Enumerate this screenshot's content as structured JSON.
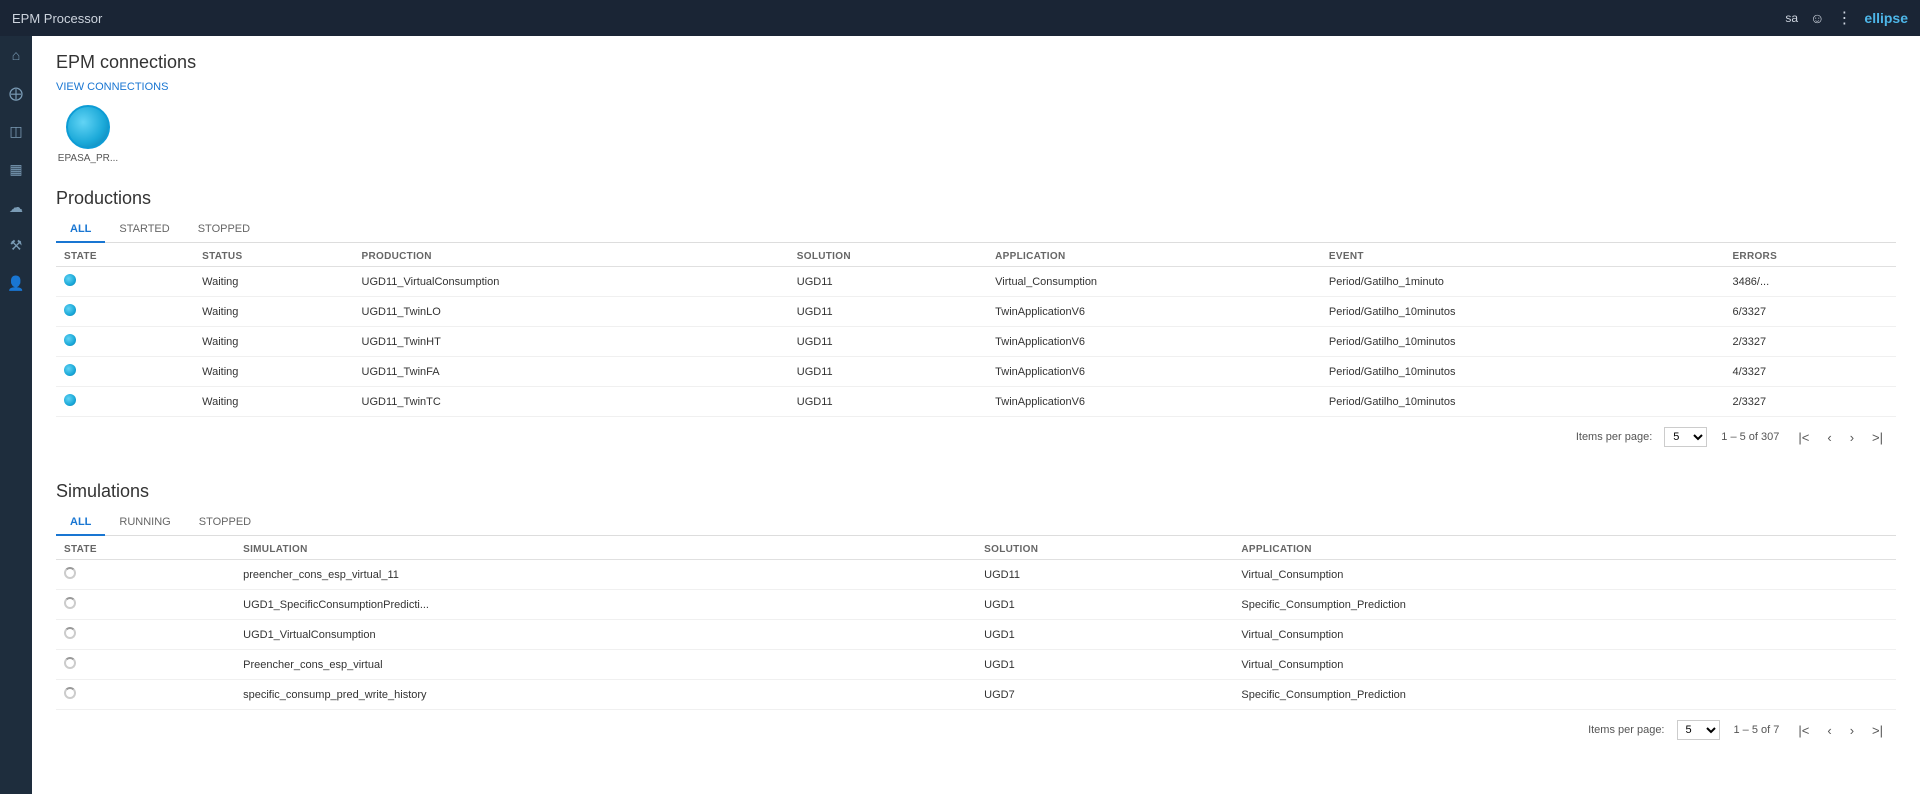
{
  "topbar": {
    "title": "EPM Processor",
    "user": "sa",
    "logo": "ellipse"
  },
  "sidebar": {
    "icons": [
      {
        "name": "home-icon",
        "glyph": "⌂"
      },
      {
        "name": "settings-icon",
        "glyph": "⚙"
      },
      {
        "name": "layers-icon",
        "glyph": "⊞"
      },
      {
        "name": "chart-icon",
        "glyph": "◫"
      },
      {
        "name": "cloud-icon",
        "glyph": "☁"
      },
      {
        "name": "tools-icon",
        "glyph": "⚒"
      },
      {
        "name": "users-icon",
        "glyph": "👤"
      }
    ]
  },
  "epm_connections": {
    "section_title": "EPM connections",
    "view_connections_label": "VIEW CONNECTIONS",
    "connection_name": "EPASA_PR..."
  },
  "productions": {
    "section_title": "Productions",
    "tabs": [
      {
        "label": "ALL",
        "active": true
      },
      {
        "label": "STARTED",
        "active": false
      },
      {
        "label": "STOPPED",
        "active": false
      }
    ],
    "columns": [
      "STATE",
      "STATUS",
      "PRODUCTION",
      "SOLUTION",
      "APPLICATION",
      "EVENT",
      "ERRORS"
    ],
    "rows": [
      {
        "state": "dot",
        "status": "Waiting",
        "production": "UGD11_VirtualConsumption",
        "solution": "UGD11",
        "application": "Virtual_Consumption",
        "event": "Period/Gatilho_1minuto",
        "errors": "3486/..."
      },
      {
        "state": "dot",
        "status": "Waiting",
        "production": "UGD11_TwinLO",
        "solution": "UGD11",
        "application": "TwinApplicationV6",
        "event": "Period/Gatilho_10minutos",
        "errors": "6/3327"
      },
      {
        "state": "dot",
        "status": "Waiting",
        "production": "UGD11_TwinHT",
        "solution": "UGD11",
        "application": "TwinApplicationV6",
        "event": "Period/Gatilho_10minutos",
        "errors": "2/3327"
      },
      {
        "state": "dot",
        "status": "Waiting",
        "production": "UGD11_TwinFA",
        "solution": "UGD11",
        "application": "TwinApplicationV6",
        "event": "Period/Gatilho_10minutos",
        "errors": "4/3327"
      },
      {
        "state": "dot",
        "status": "Waiting",
        "production": "UGD11_TwinTC",
        "solution": "UGD11",
        "application": "TwinApplicationV6",
        "event": "Period/Gatilho_10minutos",
        "errors": "2/3327"
      }
    ],
    "pagination": {
      "items_per_page_label": "Items per page:",
      "items_per_page": "5",
      "range": "1 – 5 of 307"
    }
  },
  "simulations": {
    "section_title": "Simulations",
    "tabs": [
      {
        "label": "ALL",
        "active": true
      },
      {
        "label": "RUNNING",
        "active": false
      },
      {
        "label": "STOPPED",
        "active": false
      }
    ],
    "columns": [
      "STATE",
      "SIMULATION",
      "SOLUTION",
      "APPLICATION"
    ],
    "rows": [
      {
        "state": "spinner",
        "simulation": "preencher_cons_esp_virtual_11",
        "solution": "UGD11",
        "application": "Virtual_Consumption"
      },
      {
        "state": "spinner",
        "simulation": "UGD1_SpecificConsumptionPredicti...",
        "solution": "UGD1",
        "application": "Specific_Consumption_Prediction"
      },
      {
        "state": "spinner",
        "simulation": "UGD1_VirtualConsumption",
        "solution": "UGD1",
        "application": "Virtual_Consumption"
      },
      {
        "state": "spinner",
        "simulation": "Preencher_cons_esp_virtual",
        "solution": "UGD1",
        "application": "Virtual_Consumption"
      },
      {
        "state": "spinner",
        "simulation": "specific_consump_pred_write_history",
        "solution": "UGD7",
        "application": "Specific_Consumption_Prediction"
      }
    ],
    "pagination": {
      "items_per_page_label": "Items per page:",
      "items_per_page": "5",
      "range": "1 – 5 of 7"
    }
  }
}
